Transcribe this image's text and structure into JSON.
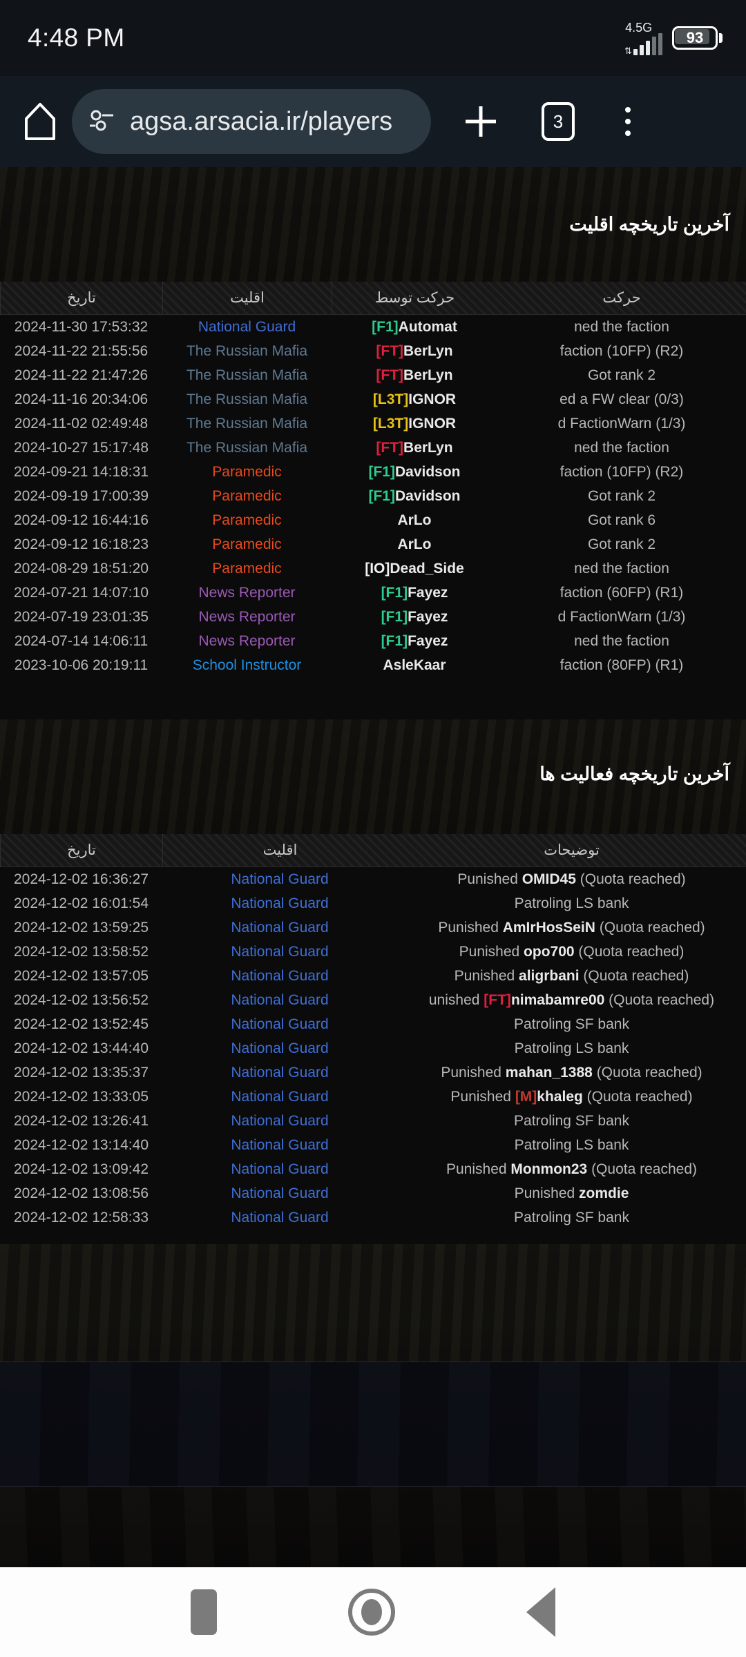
{
  "status_bar": {
    "time": "4:48 PM",
    "network_label": "4.5G",
    "battery_level": "93",
    "signal_icon": "signal-bars-icon",
    "battery_icon": "battery-icon"
  },
  "browser": {
    "home_icon": "home-icon",
    "site_info_icon": "page-info-icon",
    "url": "agsa.arsacia.ir/players",
    "new_tab_icon": "plus-icon",
    "tab_count": "3",
    "menu_icon": "overflow-menu-icon"
  },
  "sections": [
    {
      "title": "آخرین تاریخچه اقلیت",
      "columns": [
        "تاریخ",
        "اقلیت",
        "حرکت توسط",
        "حرکت"
      ],
      "rows": [
        {
          "date": "2024-11-30 17:53:32",
          "faction": "National Guard",
          "faction_color": "#3f6fd8",
          "tag": "[F1]",
          "tag_color": "#2ecc8f",
          "name": "Automat",
          "action": "ned the faction"
        },
        {
          "date": "2024-11-22 21:55:56",
          "faction": "The Russian Mafia",
          "faction_color": "#5d7a93",
          "tag": "[FT]",
          "tag_color": "#e02040",
          "name": "BerLyn",
          "action": "faction (10FP) (R2)"
        },
        {
          "date": "2024-11-22 21:47:26",
          "faction": "The Russian Mafia",
          "faction_color": "#5d7a93",
          "tag": "[FT]",
          "tag_color": "#e02040",
          "name": "BerLyn",
          "action": "Got rank 2"
        },
        {
          "date": "2024-11-16 20:34:06",
          "faction": "The Russian Mafia",
          "faction_color": "#5d7a93",
          "tag": "[L3T]",
          "tag_color": "#e8c21a",
          "name": "IGNOR",
          "action": "ed a FW clear (0/3)"
        },
        {
          "date": "2024-11-02 02:49:48",
          "faction": "The Russian Mafia",
          "faction_color": "#5d7a93",
          "tag": "[L3T]",
          "tag_color": "#e8c21a",
          "name": "IGNOR",
          "action": "d FactionWarn (1/3)"
        },
        {
          "date": "2024-10-27 15:17:48",
          "faction": "The Russian Mafia",
          "faction_color": "#5d7a93",
          "tag": "[FT]",
          "tag_color": "#e02040",
          "name": "BerLyn",
          "action": "ned the faction"
        },
        {
          "date": "2024-09-21 14:18:31",
          "faction": "Paramedic",
          "faction_color": "#e8491d",
          "tag": "[F1]",
          "tag_color": "#2ecc8f",
          "name": "Davidson",
          "action": "faction (10FP) (R2)"
        },
        {
          "date": "2024-09-19 17:00:39",
          "faction": "Paramedic",
          "faction_color": "#e8491d",
          "tag": "[F1]",
          "tag_color": "#2ecc8f",
          "name": "Davidson",
          "action": "Got rank 2"
        },
        {
          "date": "2024-09-12 16:44:16",
          "faction": "Paramedic",
          "faction_color": "#e8491d",
          "tag": "",
          "tag_color": "#2ecc8f",
          "name": "ArLo",
          "action": "Got rank 6"
        },
        {
          "date": "2024-09-12 16:18:23",
          "faction": "Paramedic",
          "faction_color": "#e8491d",
          "tag": "",
          "tag_color": "#2ecc8f",
          "name": "ArLo",
          "action": "Got rank 2"
        },
        {
          "date": "2024-08-29 18:51:20",
          "faction": "Paramedic",
          "faction_color": "#e8491d",
          "tag": "[IO]",
          "tag_color": "#f2f2f2",
          "name": "Dead_Side",
          "action": "ned the faction"
        },
        {
          "date": "2024-07-21 14:07:10",
          "faction": "News Reporter",
          "faction_color": "#9b59b6",
          "tag": "[F1]",
          "tag_color": "#2ecc8f",
          "name": "Fayez",
          "action": "faction (60FP) (R1)"
        },
        {
          "date": "2024-07-19 23:01:35",
          "faction": "News Reporter",
          "faction_color": "#9b59b6",
          "tag": "[F1]",
          "tag_color": "#2ecc8f",
          "name": "Fayez",
          "action": "d FactionWarn (1/3)"
        },
        {
          "date": "2024-07-14 14:06:11",
          "faction": "News Reporter",
          "faction_color": "#9b59b6",
          "tag": "[F1]",
          "tag_color": "#2ecc8f",
          "name": "Fayez",
          "action": "ned the faction"
        },
        {
          "date": "2023-10-06 20:19:11",
          "faction": "School Instructor",
          "faction_color": "#1f8fe0",
          "tag": "",
          "tag_color": "#2ecc8f",
          "name": "AsleKaar",
          "action": "faction (80FP) (R1)"
        }
      ]
    },
    {
      "title": "آخرین تاریخچه فعالیت ها",
      "columns": [
        "تاریخ",
        "اقلیت",
        "توضیحات"
      ],
      "rows": [
        {
          "date": "2024-12-02 16:36:27",
          "faction": "National Guard",
          "faction_color": "#3f6fd8",
          "prefix": "Punished ",
          "tag": "",
          "tag_color": "#e02040",
          "name": "OMID45",
          "suffix": " (Quota reached)"
        },
        {
          "date": "2024-12-02 16:01:54",
          "faction": "National Guard",
          "faction_color": "#3f6fd8",
          "prefix": "Patroling LS bank",
          "tag": "",
          "tag_color": "#e02040",
          "name": "",
          "suffix": ""
        },
        {
          "date": "2024-12-02 13:59:25",
          "faction": "National Guard",
          "faction_color": "#3f6fd8",
          "prefix": "Punished ",
          "tag": "",
          "tag_color": "#e02040",
          "name": "AmIrHosSeiN",
          "suffix": " (Quota reached)"
        },
        {
          "date": "2024-12-02 13:58:52",
          "faction": "National Guard",
          "faction_color": "#3f6fd8",
          "prefix": "Punished ",
          "tag": "",
          "tag_color": "#e02040",
          "name": "opo700",
          "suffix": " (Quota reached)"
        },
        {
          "date": "2024-12-02 13:57:05",
          "faction": "National Guard",
          "faction_color": "#3f6fd8",
          "prefix": "Punished ",
          "tag": "",
          "tag_color": "#e02040",
          "name": "aligrbani",
          "suffix": " (Quota reached)"
        },
        {
          "date": "2024-12-02 13:56:52",
          "faction": "National Guard",
          "faction_color": "#3f6fd8",
          "prefix": "unished ",
          "tag": "[FT]",
          "tag_color": "#e02040",
          "name": "nimabamre00",
          "suffix": " (Quota reached)"
        },
        {
          "date": "2024-12-02 13:52:45",
          "faction": "National Guard",
          "faction_color": "#3f6fd8",
          "prefix": "Patroling SF bank",
          "tag": "",
          "tag_color": "#e02040",
          "name": "",
          "suffix": ""
        },
        {
          "date": "2024-12-02 13:44:40",
          "faction": "National Guard",
          "faction_color": "#3f6fd8",
          "prefix": "Patroling LS bank",
          "tag": "",
          "tag_color": "#e02040",
          "name": "",
          "suffix": ""
        },
        {
          "date": "2024-12-02 13:35:37",
          "faction": "National Guard",
          "faction_color": "#3f6fd8",
          "prefix": "Punished ",
          "tag": "",
          "tag_color": "#e02040",
          "name": "mahan_1388",
          "suffix": " (Quota reached)"
        },
        {
          "date": "2024-12-02 13:33:05",
          "faction": "National Guard",
          "faction_color": "#3f6fd8",
          "prefix": "Punished ",
          "tag": "[M]",
          "tag_color": "#c0392b",
          "name": "khaleg",
          "suffix": " (Quota reached)"
        },
        {
          "date": "2024-12-02 13:26:41",
          "faction": "National Guard",
          "faction_color": "#3f6fd8",
          "prefix": "Patroling SF bank",
          "tag": "",
          "tag_color": "#e02040",
          "name": "",
          "suffix": ""
        },
        {
          "date": "2024-12-02 13:14:40",
          "faction": "National Guard",
          "faction_color": "#3f6fd8",
          "prefix": "Patroling LS bank",
          "tag": "",
          "tag_color": "#e02040",
          "name": "",
          "suffix": ""
        },
        {
          "date": "2024-12-02 13:09:42",
          "faction": "National Guard",
          "faction_color": "#3f6fd8",
          "prefix": "Punished ",
          "tag": "",
          "tag_color": "#e02040",
          "name": "Monmon23",
          "suffix": " (Quota reached)"
        },
        {
          "date": "2024-12-02 13:08:56",
          "faction": "National Guard",
          "faction_color": "#3f6fd8",
          "prefix": "Punished ",
          "tag": "",
          "tag_color": "#e02040",
          "name": "zomdie",
          "suffix": ""
        },
        {
          "date": "2024-12-02 12:58:33",
          "faction": "National Guard",
          "faction_color": "#3f6fd8",
          "prefix": "Patroling SF bank",
          "tag": "",
          "tag_color": "#e02040",
          "name": "",
          "suffix": ""
        }
      ]
    }
  ],
  "nav_bar": {
    "recent_icon": "recent-apps-icon",
    "home_icon": "home-circle-icon",
    "back_icon": "back-triangle-icon"
  }
}
